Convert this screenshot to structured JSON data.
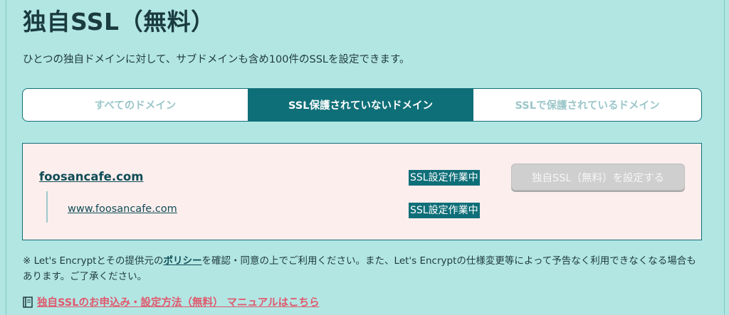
{
  "section": {
    "title": "独自SSL（無料）",
    "description": "ひとつの独自ドメインに対して、サブドメインも含め100件のSSLを設定できます。"
  },
  "tabs": [
    {
      "label": "すべてのドメイン",
      "active": false
    },
    {
      "label": "SSL保護されていないドメイン",
      "active": true
    },
    {
      "label": "SSLで保護されているドメイン",
      "active": false
    }
  ],
  "domains": {
    "main": {
      "name": "foosancafe.com",
      "status": "SSL設定作業中"
    },
    "sub": {
      "name": "www.foosancafe.com",
      "status": "SSL設定作業中"
    },
    "set_button_label": "独自SSL（無料）を設定する"
  },
  "note": {
    "prefix": "※ Let's Encryptとその提供元の",
    "policy_link": "ポリシー",
    "suffix": "を確認・同意の上でご利用ください。また、Let's Encryptの仕様変更等によって予告なく利用できなくなる場合もあります。ご了承ください。"
  },
  "manual_link": "独自SSLのお申込み・設定方法（無料） マニュアルはこちら",
  "colors": {
    "background": "#b2e6e3",
    "accent": "#0f6f78",
    "domain_panel_bg": "#fdeeee",
    "manual_link": "#e0586c"
  }
}
